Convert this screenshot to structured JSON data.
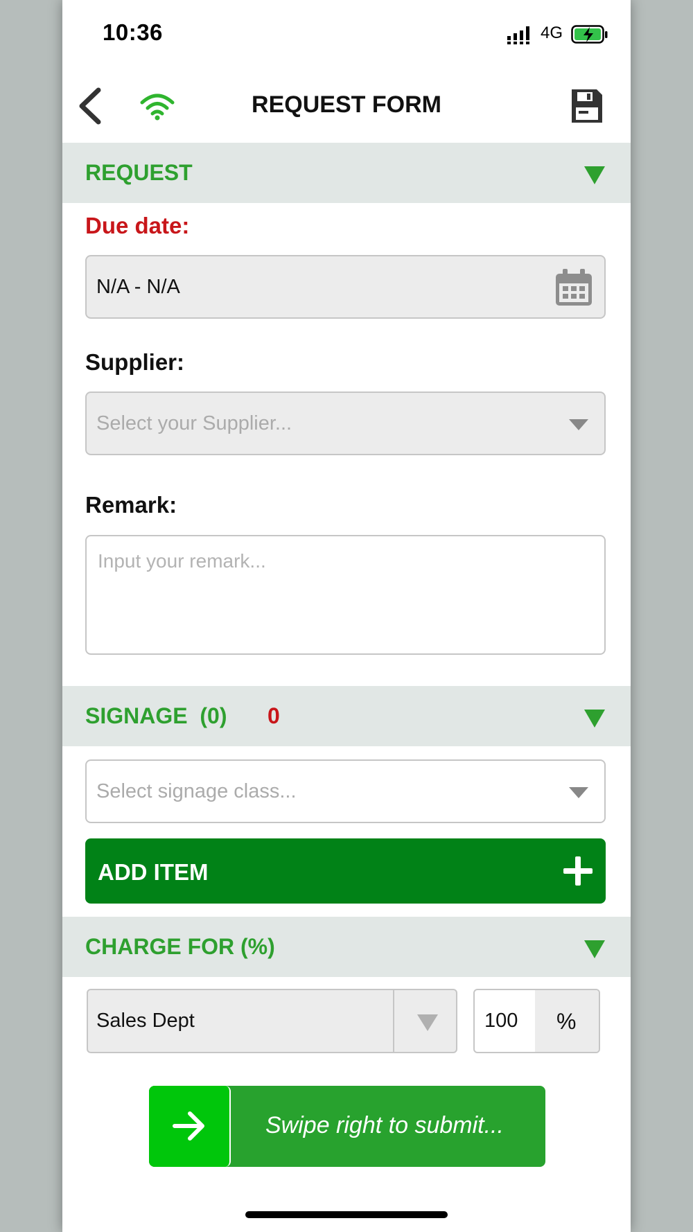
{
  "status_bar": {
    "time": "10:36",
    "network": "4G"
  },
  "header": {
    "title": "REQUEST FORM"
  },
  "request_section": {
    "title": "REQUEST",
    "due_date": {
      "label": "Due date:",
      "value": "N/A - N/A"
    },
    "supplier": {
      "label": "Supplier:",
      "placeholder": "Select your Supplier..."
    },
    "remark": {
      "label": "Remark:",
      "placeholder": "Input your remark..."
    }
  },
  "signage_section": {
    "title": "SIGNAGE  (0)",
    "count": "0",
    "class_placeholder": "Select signage class...",
    "add_item_label": "ADD ITEM"
  },
  "charge_section": {
    "title": "CHARGE FOR (%)",
    "department": "Sales Dept",
    "percent_value": "100",
    "percent_unit": "%"
  },
  "submit": {
    "label": "Swipe right to submit..."
  },
  "colors": {
    "accent_green": "#2ea02f",
    "required_red": "#c8161a",
    "add_button": "#018217",
    "swipe_bg": "#28a22e",
    "swipe_handle": "#00c60b"
  },
  "icons": {
    "back": "chevron-left-icon",
    "connection": "wifi-icon",
    "save": "floppy-disk-icon",
    "calendar": "calendar-icon",
    "dropdown": "caret-down-icon",
    "add": "plus-icon",
    "swipe": "arrow-right-icon"
  }
}
